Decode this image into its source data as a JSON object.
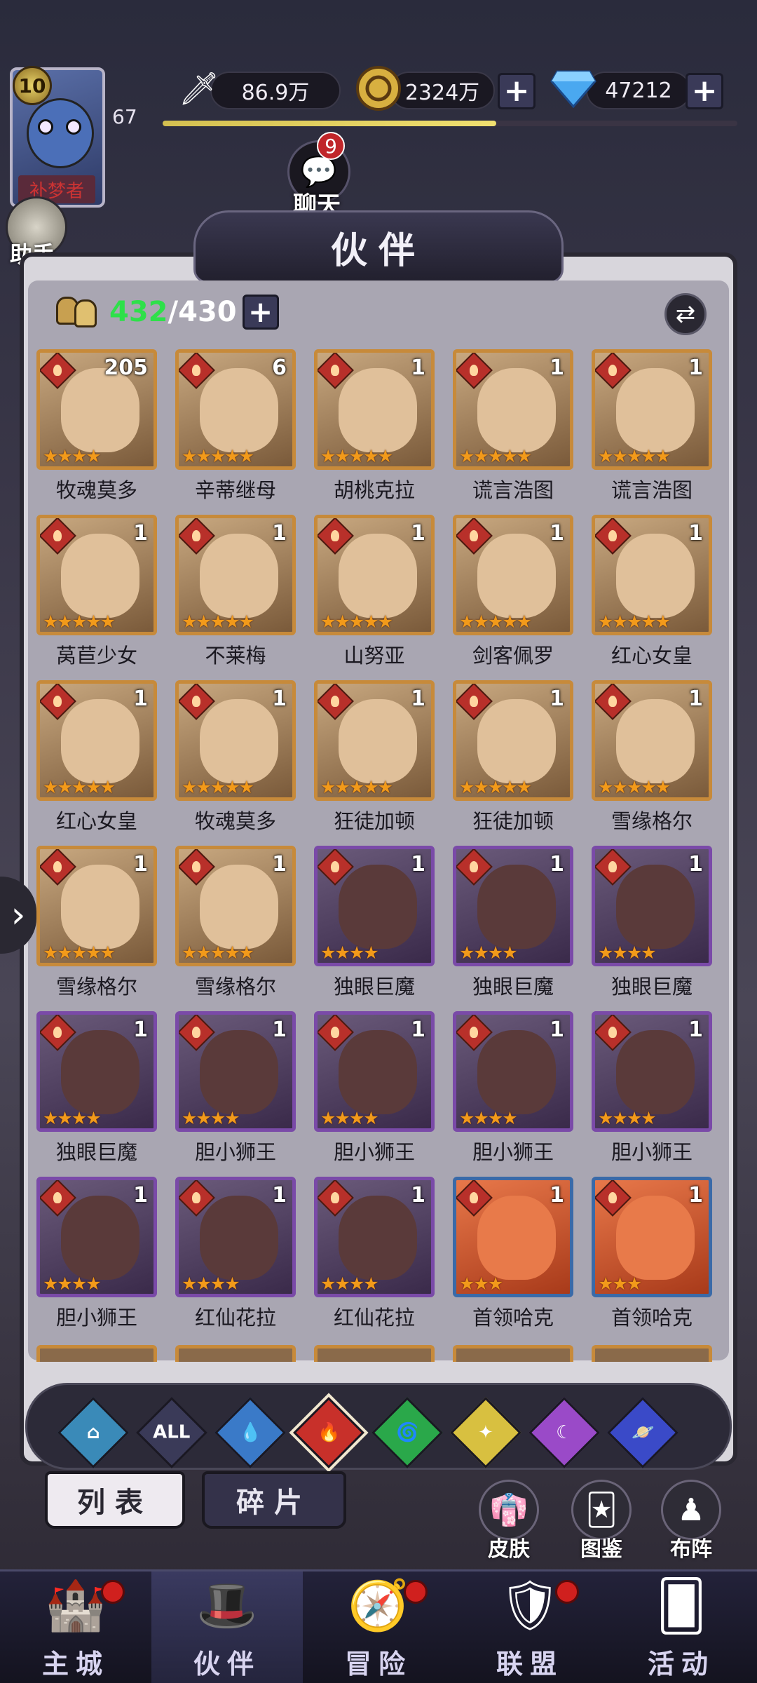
{
  "player": {
    "level": "10",
    "xp_level": "67",
    "title_text": "补梦者",
    "xp_progress": 0.58
  },
  "resources": {
    "power": "86.9万",
    "gold": "2324万",
    "diamonds": "47212"
  },
  "assistant": {
    "label": "助手"
  },
  "chat": {
    "label": "聊天",
    "badge": "9"
  },
  "panel": {
    "title": "伙伴",
    "hero_count_current": "432",
    "hero_count_max": "/430"
  },
  "heroes": [
    {
      "name": "牧魂莫多",
      "copies": "205",
      "stars": 4,
      "frame": "brown"
    },
    {
      "name": "辛蒂继母",
      "copies": "6",
      "stars": 5,
      "frame": "brown"
    },
    {
      "name": "胡桃克拉",
      "copies": "1",
      "stars": 5,
      "frame": "brown"
    },
    {
      "name": "谎言浩图",
      "copies": "1",
      "stars": 5,
      "frame": "brown"
    },
    {
      "name": "谎言浩图",
      "copies": "1",
      "stars": 5,
      "frame": "brown"
    },
    {
      "name": "莴苣少女",
      "copies": "1",
      "stars": 5,
      "frame": "brown"
    },
    {
      "name": "不莱梅",
      "copies": "1",
      "stars": 5,
      "frame": "brown"
    },
    {
      "name": "山努亚",
      "copies": "1",
      "stars": 5,
      "frame": "brown"
    },
    {
      "name": "剑客佩罗",
      "copies": "1",
      "stars": 5,
      "frame": "brown"
    },
    {
      "name": "红心女皇",
      "copies": "1",
      "stars": 5,
      "frame": "brown"
    },
    {
      "name": "红心女皇",
      "copies": "1",
      "stars": 5,
      "frame": "brown"
    },
    {
      "name": "牧魂莫多",
      "copies": "1",
      "stars": 5,
      "frame": "brown"
    },
    {
      "name": "狂徒加顿",
      "copies": "1",
      "stars": 5,
      "frame": "brown"
    },
    {
      "name": "狂徒加顿",
      "copies": "1",
      "stars": 5,
      "frame": "brown"
    },
    {
      "name": "雪缘格尔",
      "copies": "1",
      "stars": 5,
      "frame": "brown"
    },
    {
      "name": "雪缘格尔",
      "copies": "1",
      "stars": 5,
      "frame": "brown"
    },
    {
      "name": "雪缘格尔",
      "copies": "1",
      "stars": 5,
      "frame": "brown"
    },
    {
      "name": "独眼巨魔",
      "copies": "1",
      "stars": 4,
      "frame": "purple"
    },
    {
      "name": "独眼巨魔",
      "copies": "1",
      "stars": 4,
      "frame": "purple"
    },
    {
      "name": "独眼巨魔",
      "copies": "1",
      "stars": 4,
      "frame": "purple"
    },
    {
      "name": "独眼巨魔",
      "copies": "1",
      "stars": 4,
      "frame": "purple"
    },
    {
      "name": "胆小狮王",
      "copies": "1",
      "stars": 4,
      "frame": "purple"
    },
    {
      "name": "胆小狮王",
      "copies": "1",
      "stars": 4,
      "frame": "purple"
    },
    {
      "name": "胆小狮王",
      "copies": "1",
      "stars": 4,
      "frame": "purple"
    },
    {
      "name": "胆小狮王",
      "copies": "1",
      "stars": 4,
      "frame": "purple"
    },
    {
      "name": "胆小狮王",
      "copies": "1",
      "stars": 4,
      "frame": "purple"
    },
    {
      "name": "红仙花拉",
      "copies": "1",
      "stars": 4,
      "frame": "purple"
    },
    {
      "name": "红仙花拉",
      "copies": "1",
      "stars": 4,
      "frame": "purple"
    },
    {
      "name": "首领哈克",
      "copies": "1",
      "stars": 3,
      "frame": "blue"
    },
    {
      "name": "首领哈克",
      "copies": "1",
      "stars": 3,
      "frame": "blue"
    }
  ],
  "filters": [
    {
      "icon": "shield-element-icon",
      "color": "#3a8ab8"
    },
    {
      "icon": "all-label",
      "label": "ALL",
      "color": "#3a3a58"
    },
    {
      "icon": "water-drop-icon",
      "color": "#3a7ac8"
    },
    {
      "icon": "fire-icon",
      "color": "#c8302a",
      "selected": true
    },
    {
      "icon": "wind-icon",
      "color": "#2aa84a"
    },
    {
      "icon": "light-icon",
      "color": "#d8c040"
    },
    {
      "icon": "moon-icon",
      "color": "#9a4ac8"
    },
    {
      "icon": "planet-icon",
      "color": "#3a4ac8"
    }
  ],
  "tabs": {
    "list": "列表",
    "fragments": "碎片"
  },
  "side_buttons": {
    "skin": "皮肤",
    "codex": "图鉴",
    "formation": "布阵"
  },
  "nav": [
    {
      "label": "主城",
      "icon": "castle-icon",
      "dot": true
    },
    {
      "label": "伙伴",
      "icon": "wizard-hat-icon",
      "active": true
    },
    {
      "label": "冒险",
      "icon": "compass-icon",
      "dot": true
    },
    {
      "label": "联盟",
      "icon": "guild-shield-icon",
      "dot": true
    },
    {
      "label": "活动",
      "icon": "cards-icon"
    }
  ]
}
